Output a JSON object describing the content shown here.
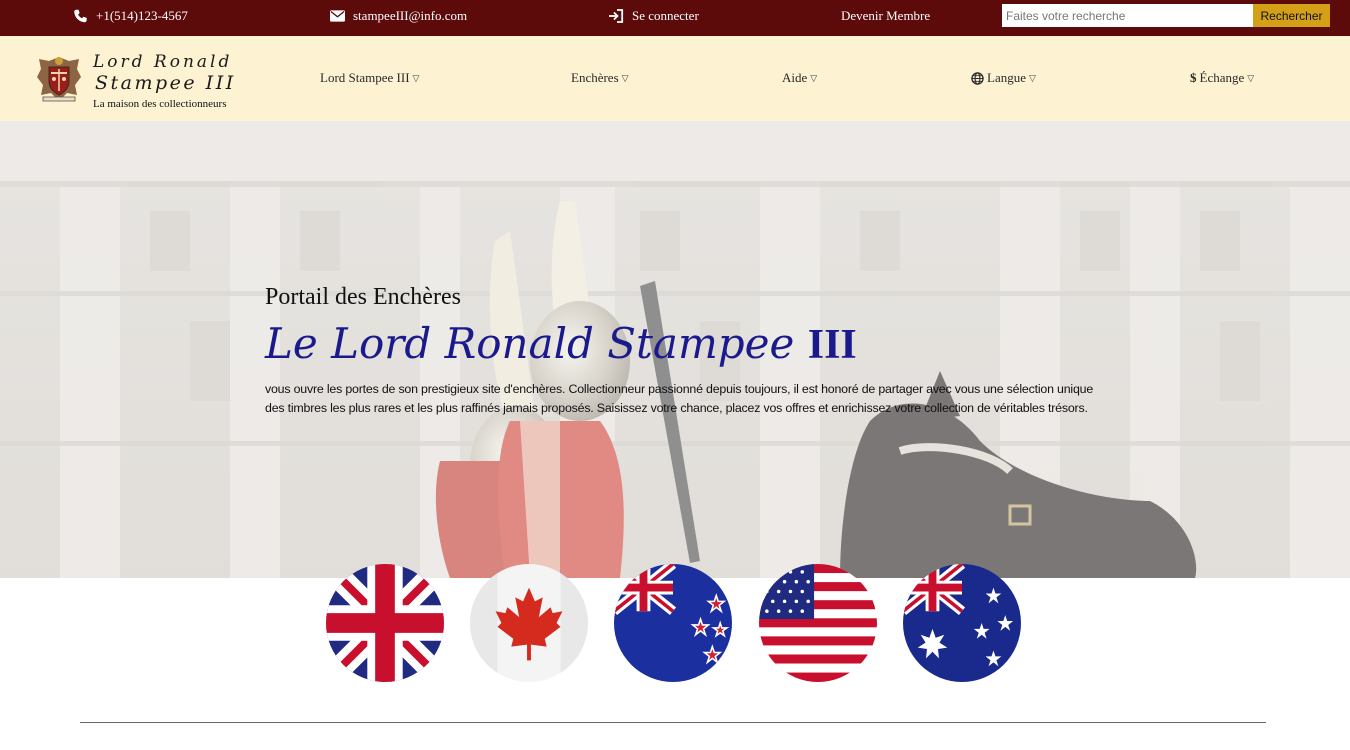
{
  "topbar": {
    "phone": "+1(514)123-4567",
    "email": "stampeeIII@info.com",
    "login": "Se connecter",
    "member": "Devenir Membre",
    "search_placeholder": "Faites votre recherche",
    "search_button": "Rechercher",
    "icons": [
      "phone-icon",
      "envelope-icon",
      "sign-in-icon"
    ],
    "background": "#5c0a0a",
    "button_color": "#d4a017"
  },
  "logo": {
    "line1": "Lord Ronald",
    "line2": "Stampee III",
    "tagline": "La maison des collectionneurs"
  },
  "nav": {
    "background": "#fdf3d3",
    "items": [
      {
        "label": "Lord Stampee III"
      },
      {
        "label": "Enchères"
      },
      {
        "label": "Aide"
      },
      {
        "label": "Langue",
        "icon": "globe-icon"
      },
      {
        "label": "Échange",
        "icon": "dollar-icon"
      }
    ]
  },
  "hero": {
    "subtitle": "Portail des Enchères",
    "title_script": "Le Lord Ronald Stampee",
    "title_roman": "III",
    "title_color": "#1a1a8c",
    "description": "vous ouvre les portes de son prestigieux site d'enchères. Collectionneur passionné depuis toujours, il est honoré de partager avec vous une sélection unique des timbres les plus rares et les plus raffinés jamais proposés. Saisissez votre chance, placez vos offres et enrichissez votre collection de véritables trésors."
  },
  "flags": [
    "uk-flag-icon",
    "canada-flag-icon",
    "new-zealand-flag-icon",
    "usa-flag-icon",
    "australia-flag-icon"
  ]
}
